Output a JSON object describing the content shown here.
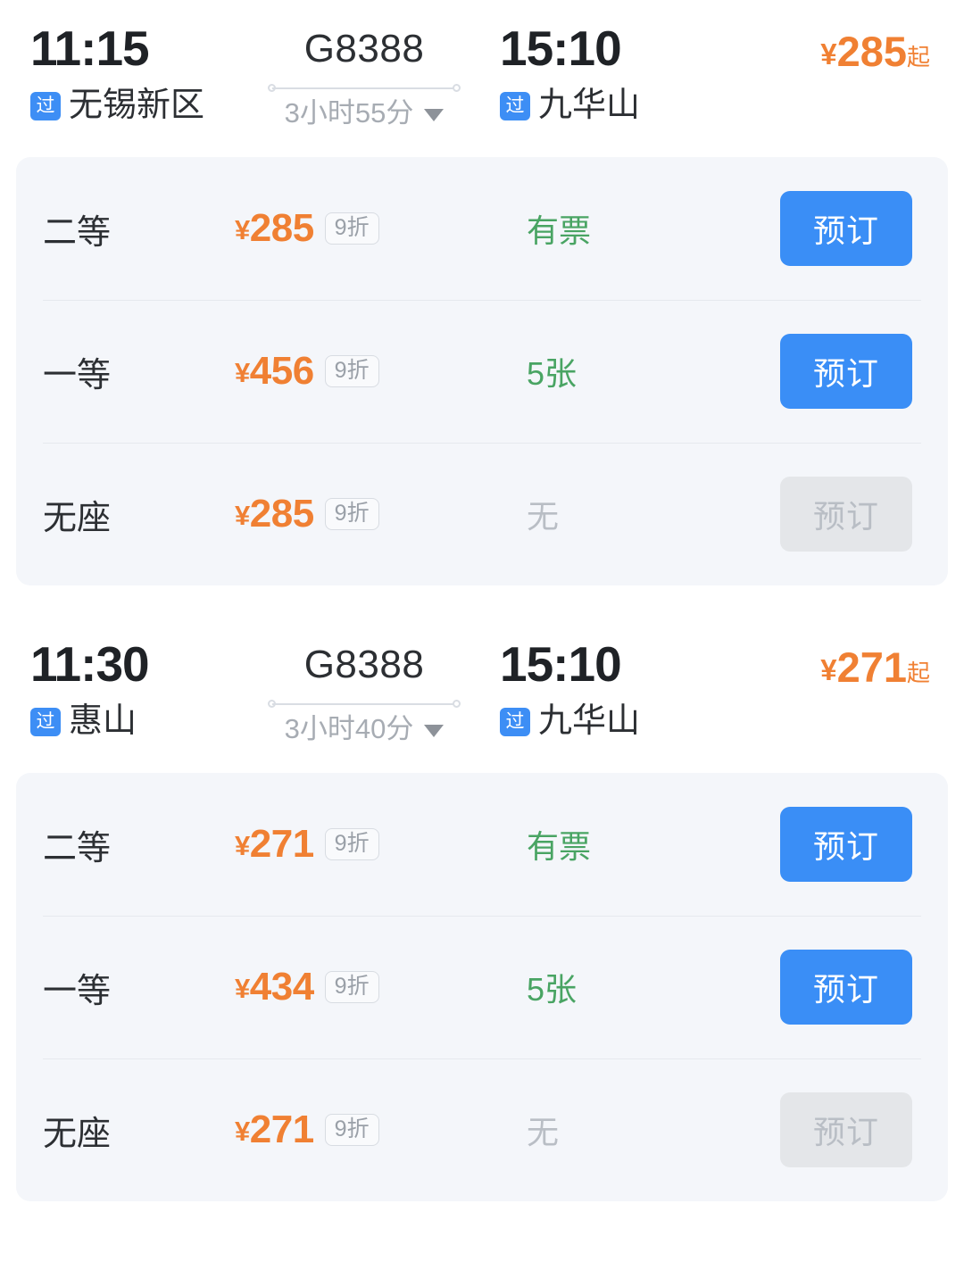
{
  "colors": {
    "accent_orange": "#f08033",
    "accent_blue": "#3a8ef6",
    "available_green": "#49a463",
    "disabled_gray": "#b9bec5",
    "panel_bg": "#f4f6fa",
    "badge_blue": "#3d8ef5"
  },
  "trains": [
    {
      "depart_time": "11:15",
      "depart_pass_badge": "过",
      "depart_station": "无锡新区",
      "train_number": "G8388",
      "duration": "3小时55分",
      "duration_caret": "caret-down-icon",
      "arrive_time": "15:10",
      "arrive_pass_badge": "过",
      "arrive_station": "九华山",
      "price_currency": "¥",
      "price_from": "285",
      "price_suffix": "起",
      "seats": [
        {
          "class_name": "二等",
          "currency": "¥",
          "price": "285",
          "discount": "9折",
          "availability": "有票",
          "available": true,
          "button_label": "预订"
        },
        {
          "class_name": "一等",
          "currency": "¥",
          "price": "456",
          "discount": "9折",
          "availability": "5张",
          "available": true,
          "button_label": "预订"
        },
        {
          "class_name": "无座",
          "currency": "¥",
          "price": "285",
          "discount": "9折",
          "availability": "无",
          "available": false,
          "button_label": "预订"
        }
      ]
    },
    {
      "depart_time": "11:30",
      "depart_pass_badge": "过",
      "depart_station": "惠山",
      "train_number": "G8388",
      "duration": "3小时40分",
      "duration_caret": "caret-down-icon",
      "arrive_time": "15:10",
      "arrive_pass_badge": "过",
      "arrive_station": "九华山",
      "price_currency": "¥",
      "price_from": "271",
      "price_suffix": "起",
      "seats": [
        {
          "class_name": "二等",
          "currency": "¥",
          "price": "271",
          "discount": "9折",
          "availability": "有票",
          "available": true,
          "button_label": "预订"
        },
        {
          "class_name": "一等",
          "currency": "¥",
          "price": "434",
          "discount": "9折",
          "availability": "5张",
          "available": true,
          "button_label": "预订"
        },
        {
          "class_name": "无座",
          "currency": "¥",
          "price": "271",
          "discount": "9折",
          "availability": "无",
          "available": false,
          "button_label": "预订"
        }
      ]
    }
  ]
}
